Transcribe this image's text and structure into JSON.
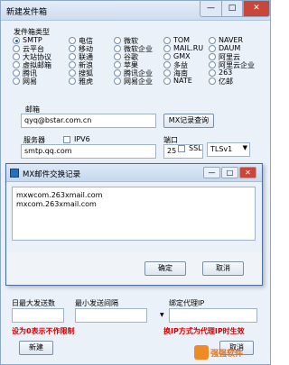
{
  "window": {
    "title": "新建发件箱",
    "minimize": "—",
    "maximize": "□",
    "close": "✕"
  },
  "mailbox_type": {
    "label": "发件箱类型",
    "options": [
      [
        "SMTP",
        "电信",
        "微软",
        "TOM",
        "NAVER"
      ],
      [
        "云平台",
        "移动",
        "微软企业",
        "MAIL.RU",
        "DAUM"
      ],
      [
        "大站协议",
        "联通",
        "谷歌",
        "GMX",
        "阿里云"
      ],
      [
        "虚拟邮箱",
        "新浪",
        "苹果",
        "多益",
        "阿里云企业"
      ],
      [
        "腾讯",
        "搜狐",
        "腾讯企业",
        "海南",
        "263"
      ],
      [
        "网易",
        "雅虎",
        "网易企业",
        "NATE",
        "亿邮"
      ]
    ],
    "selected": "SMTP"
  },
  "email": {
    "label": "邮箱",
    "value": "qyq@bstar.com.cn",
    "mx_button": "MX记录查询"
  },
  "server": {
    "label": "服务器",
    "ipv6_label": "IPV6",
    "value": "smtp.qq.com"
  },
  "port": {
    "label": "端口",
    "value": "25",
    "ssl_label": "SSL",
    "tls_value": "TLSv1"
  },
  "dialog": {
    "title": "MX邮件交换记录",
    "records": [
      "mxwcom.263xmail.com",
      "mxcom.263xmail.com"
    ],
    "ok": "确定",
    "cancel": "取消"
  },
  "bottom": {
    "daily_limit_label": "日最大发送数",
    "min_interval_label": "最小发送间隔",
    "proxy_ip_label": "绑定代理IP",
    "note_left": "设为0表示不作限制",
    "note_right": "换IP方式为代理IP时生效",
    "create_button": "新建",
    "cancel_button": "取消"
  },
  "watermark": "强强软件"
}
